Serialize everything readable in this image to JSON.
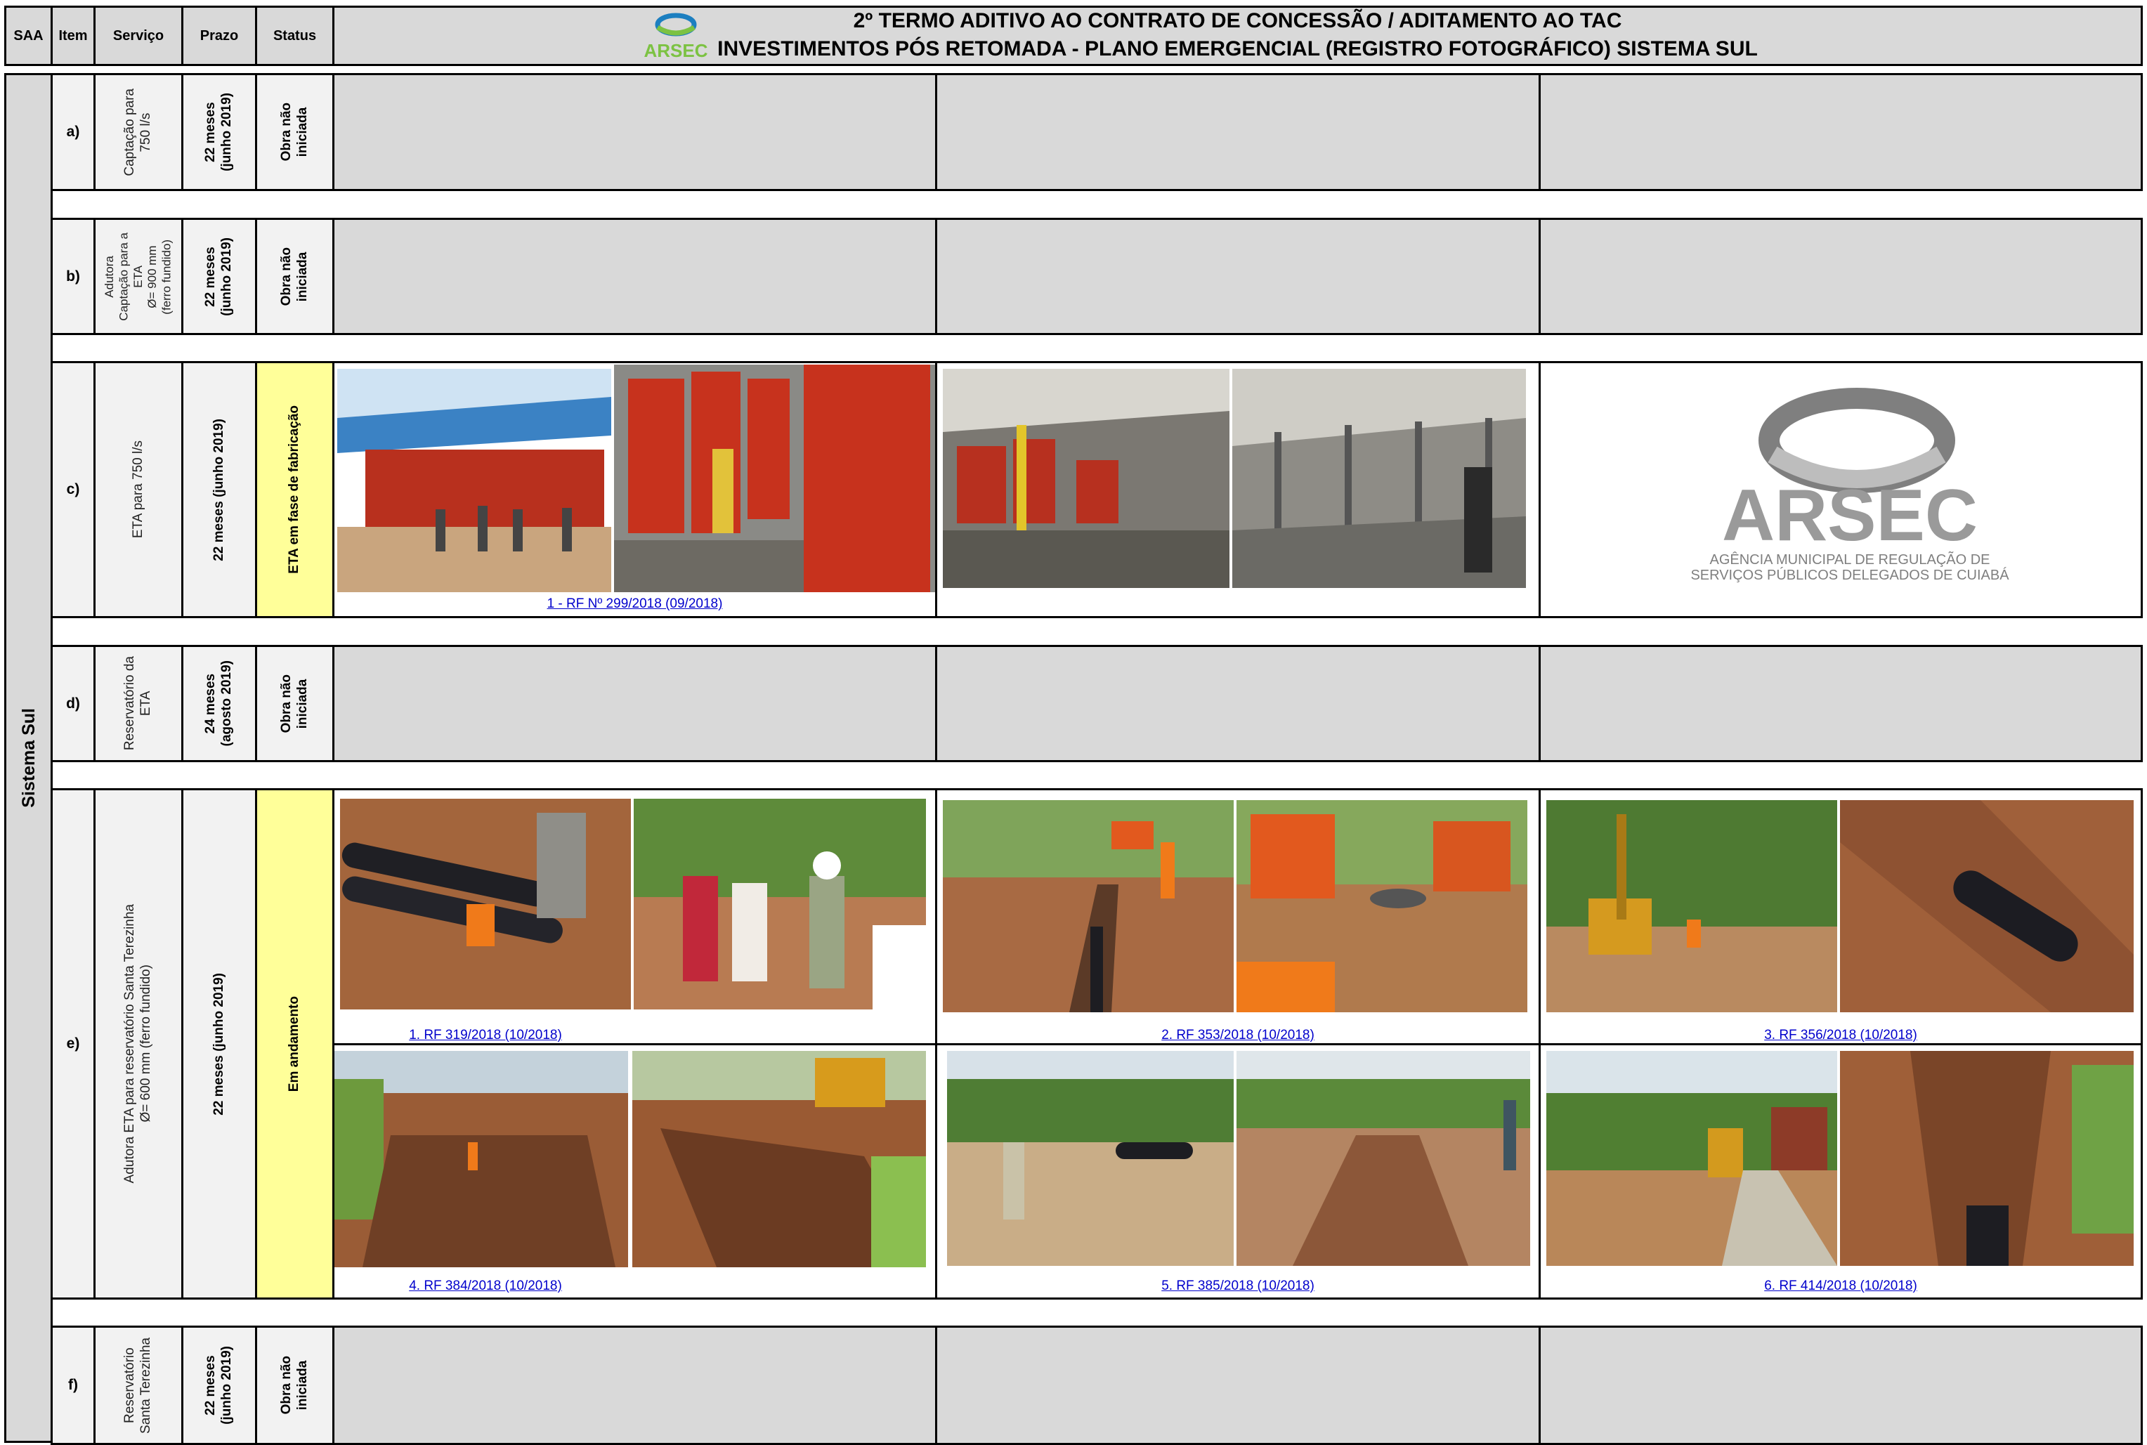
{
  "header": {
    "col_saa": "SAA",
    "col_item": "Item",
    "col_servico": "Serviço",
    "col_prazo": "Prazo",
    "col_status": "Status",
    "logo_text": "ARSEC",
    "title_line1": "2º TERMO ADITIVO AO CONTRATO DE CONCESSÃO / ADITAMENTO AO TAC",
    "title_line2": "INVESTIMENTOS PÓS RETOMADA - PLANO EMERGENCIAL (REGISTRO FOTOGRÁFICO) SISTEMA SUL"
  },
  "saa_label": "Sistema Sul",
  "rows": [
    {
      "item": "a)",
      "servico": "Captação para\n750 l/s",
      "prazo": "22 meses\n(junho 2019)",
      "status": "Obra não\niniciada"
    },
    {
      "item": "b)",
      "servico": "Adutora\nCaptação para a\nETA\nØ= 900 mm\n(ferro fundido)",
      "prazo": "22 meses\n(junho 2019)",
      "status": "Obra não\niniciada"
    },
    {
      "item": "c)",
      "servico": "ETA para 750 l/s",
      "prazo": "22 meses (junho 2019)",
      "status": "ETA em fase de fabricação",
      "caption": "1 - RF Nº 299/2018 (09/2018)",
      "logo": {
        "big": "ARSEC",
        "line1": "AGÊNCIA MUNICIPAL DE REGULAÇÃO DE",
        "line2": "SERVIÇOS PÚBLICOS DELEGADOS DE CUIABÁ"
      }
    },
    {
      "item": "d)",
      "servico": "Reservatório da\nETA",
      "prazo": "24 meses\n(agosto 2019)",
      "status": "Obra não\niniciada"
    },
    {
      "item": "e)",
      "servico": "Adutora ETA para reservatório Santa Terezinha\nØ= 600 mm (ferro fundido)",
      "prazo": "22 meses  (junho 2019)",
      "status": "Em andamento",
      "captions": [
        "1. RF 319/2018 (10/2018)",
        "2. RF 353/2018 (10/2018)",
        "3. RF 356/2018 (10/2018)",
        "4. RF 384/2018 (10/2018)",
        "5. RF 385/2018 (10/2018)",
        "6. RF 414/2018 (10/2018)"
      ]
    },
    {
      "item": "f)",
      "servico": "Reservatório\nSanta Terezinha",
      "prazo": "22 meses\n(junho 2019)",
      "status": "Obra não\niniciada"
    }
  ],
  "colors": {
    "grey": "#d9d9d9",
    "yellow": "#ffff99",
    "link": "#0000cc"
  }
}
